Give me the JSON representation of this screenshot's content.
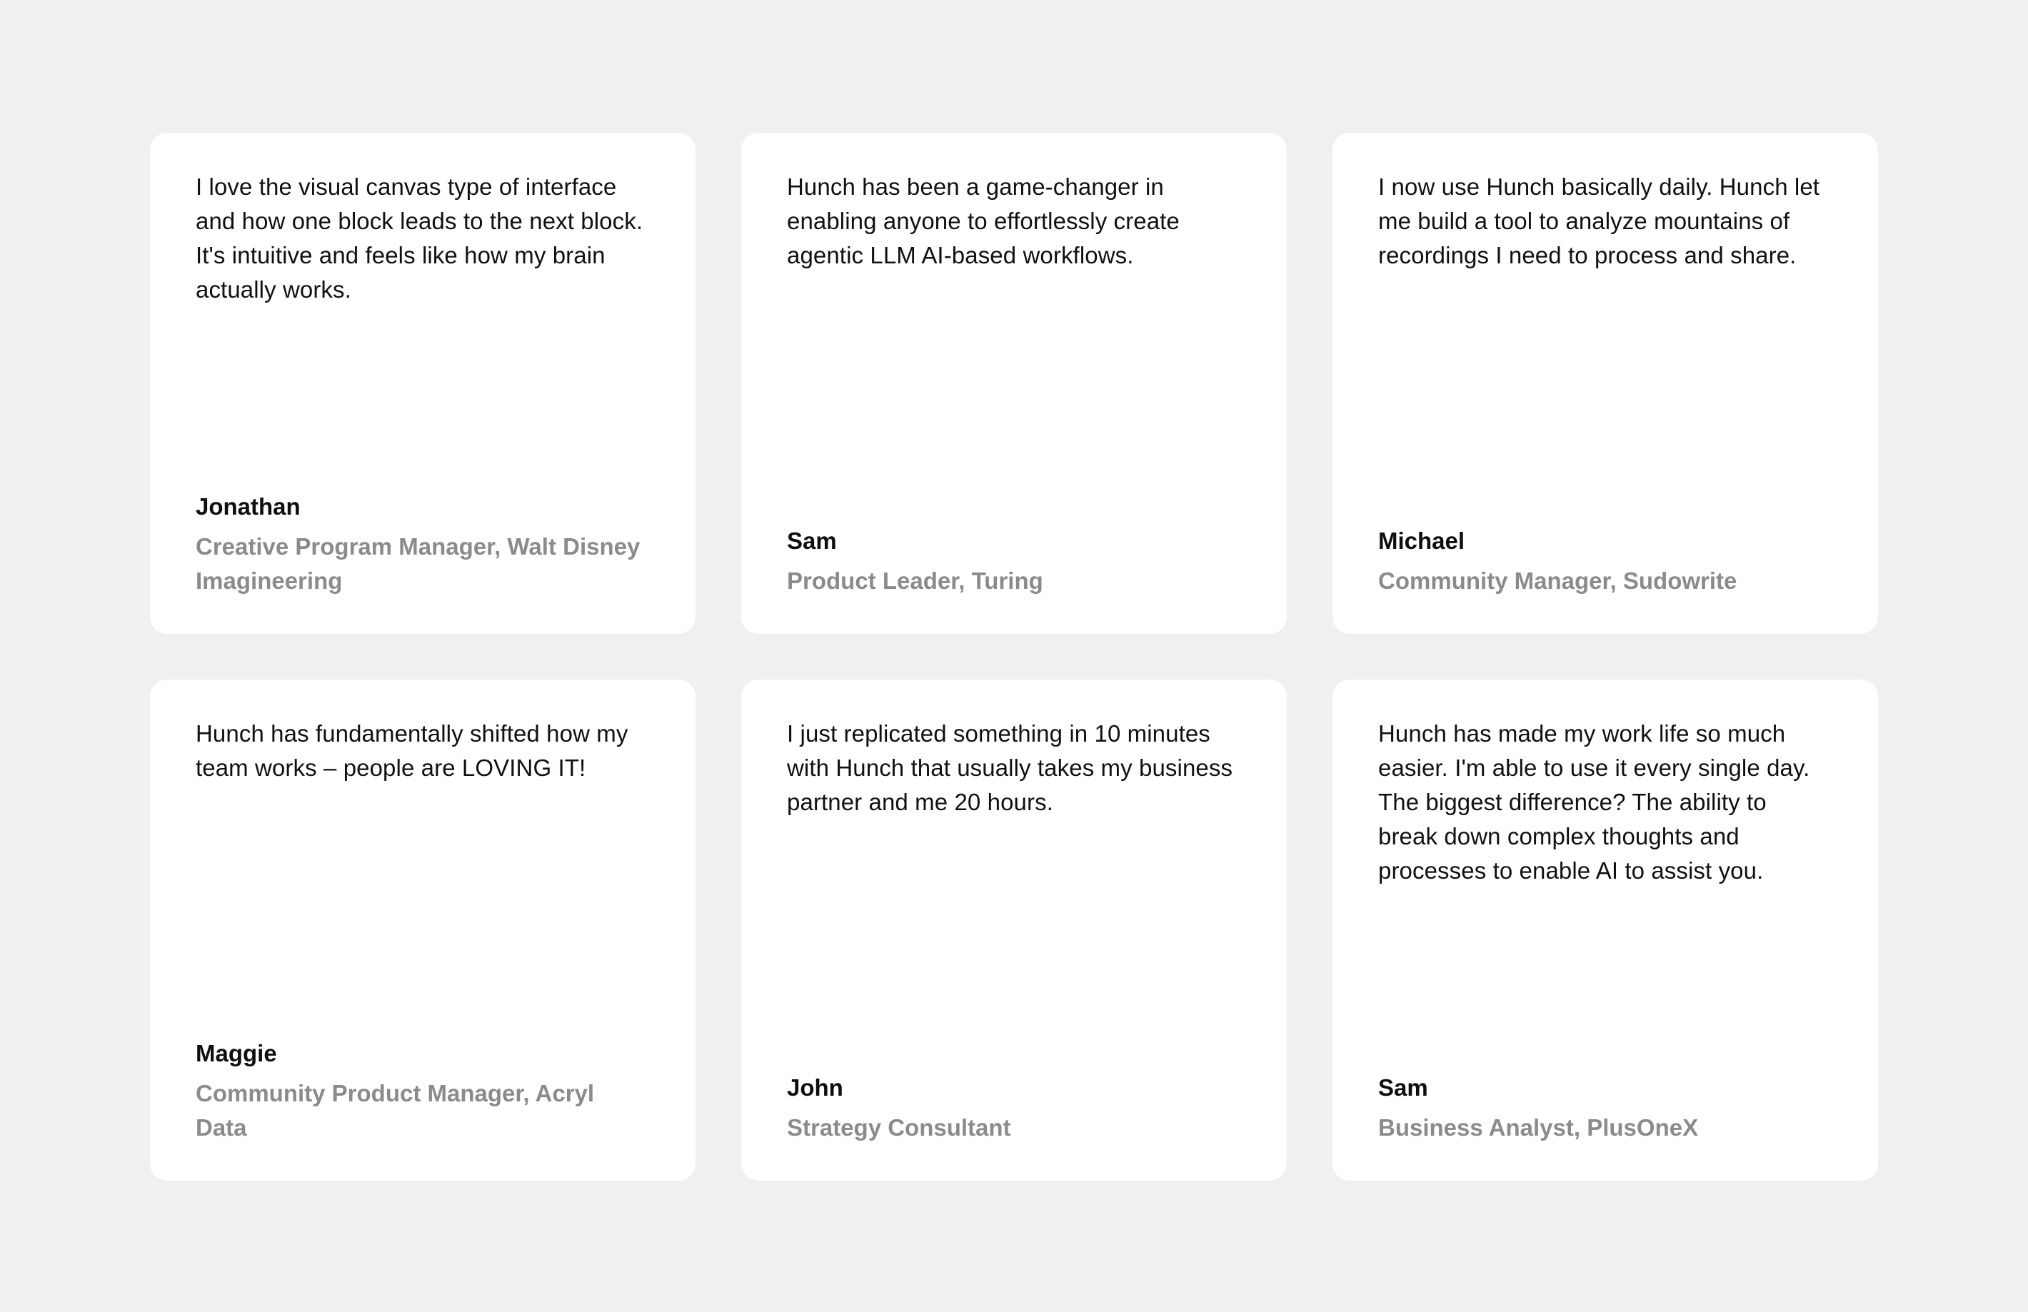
{
  "testimonials": [
    {
      "quote": "I love the visual canvas type of interface and how one block leads to the next block. It's intuitive and feels like how my brain actually works.",
      "name": "Jonathan",
      "role": "Creative Program Manager, Walt Disney Imagineering"
    },
    {
      "quote": "Hunch has been a game-changer in enabling anyone to effortlessly create agentic LLM AI-based workflows.",
      "name": "Sam",
      "role": "Product Leader, Turing"
    },
    {
      "quote": "I now use Hunch basically daily. Hunch let me build a tool to analyze mountains of recordings I need to process and share.",
      "name": "Michael",
      "role": "Community Manager, Sudowrite"
    },
    {
      "quote": "Hunch has fundamentally shifted how my team works – people are LOVING IT!",
      "name": "Maggie",
      "role": "Community Product Manager, Acryl Data"
    },
    {
      "quote": "I just replicated something in 10 minutes with Hunch that usually takes my business partner and me 20 hours.",
      "name": "John",
      "role": "Strategy Consultant"
    },
    {
      "quote": "Hunch has made my work life so much easier. I'm able to use it every single day. The biggest difference? The ability to break down complex thoughts and processes to enable AI to assist you.",
      "name": "Sam",
      "role": "Business Analyst, PlusOneX"
    }
  ]
}
